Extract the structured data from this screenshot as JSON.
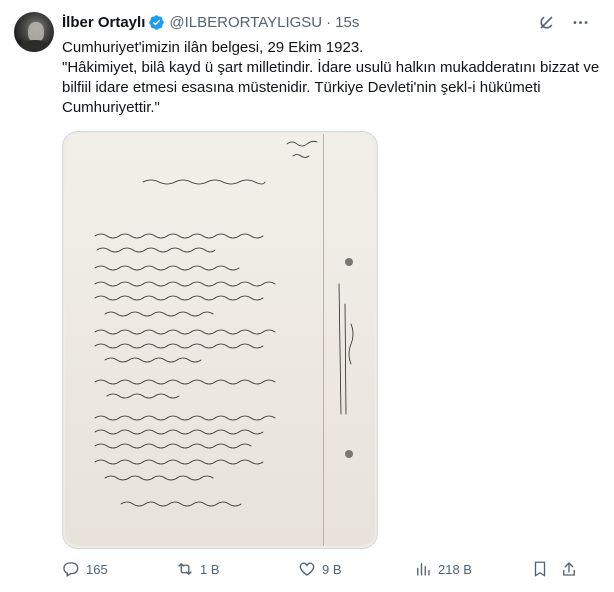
{
  "tweet": {
    "author_name": "İlber Ortaylı",
    "handle": "@ILBERORTAYLIGSU",
    "separator": "·",
    "time": "15s",
    "text_line1": "Cumhuriyet'imizin ilân belgesi, 29 Ekim 1923.",
    "text_line2": "\"Hâkimiyet, bilâ kayd ü şart milletindir. İdare usulü halkın mukadderatını bizzat ve bilfiil idare etmesi esasına müstenidir. Türkiye Devleti'nin şekl-i hükümeti Cumhuriyettir.\""
  },
  "icons": {
    "verified": "verified-badge-icon",
    "grok": "grok-icon",
    "more": "more-icon",
    "reply": "reply-icon",
    "retweet": "retweet-icon",
    "like": "like-icon",
    "views": "views-icon",
    "bookmark": "bookmark-icon",
    "share": "share-icon"
  },
  "actions": {
    "replies": "165",
    "retweets": "1 B",
    "likes": "9 B",
    "views": "218 B"
  },
  "colors": {
    "verified": "#1d9bf0",
    "text": "#0f1419",
    "secondary": "#536471"
  }
}
